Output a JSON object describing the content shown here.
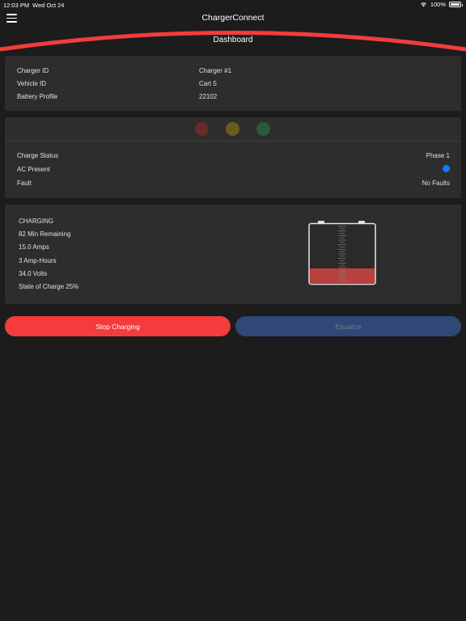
{
  "status_bar": {
    "time": "12:03 PM",
    "date": "Wed Oct 24",
    "battery": "100%"
  },
  "app": {
    "title": "ChargerConnect",
    "page_title": "Dashboard"
  },
  "info": {
    "rows": [
      {
        "label": "Charger ID",
        "value": "Charger #1"
      },
      {
        "label": "Vehicle ID",
        "value": "Cart 5"
      },
      {
        "label": "Battery Profile",
        "value": "22102"
      }
    ]
  },
  "status": {
    "lights": [
      {
        "name": "red",
        "color": "#6b2a2a"
      },
      {
        "name": "yellow",
        "color": "#6b5a1e"
      },
      {
        "name": "green",
        "color": "#2a5a36"
      }
    ],
    "charge_status_label": "Charge Status",
    "charge_status_value": "Phase 1",
    "ac_present_label": "AC Present",
    "ac_indicator_color": "#0a7cff",
    "fault_label": "Fault",
    "fault_value": "No Faults"
  },
  "charging": {
    "state": "CHARGING",
    "remaining": "82 Min Remaining",
    "amps": "15.0 Amps",
    "amp_hours": "3 Amp-Hours",
    "volts": "34.0 Volts",
    "soc_text": "State of Charge 25%",
    "soc_percent": 25,
    "fill_color": "#b8403f"
  },
  "actions": {
    "stop_label": "Stop Charging",
    "equalize_label": "Equalize"
  },
  "colors": {
    "accent": "#f43c3c",
    "equalize_bg": "#2f4875",
    "background": "#1c1c1c",
    "panel": "#2d2d2d"
  }
}
